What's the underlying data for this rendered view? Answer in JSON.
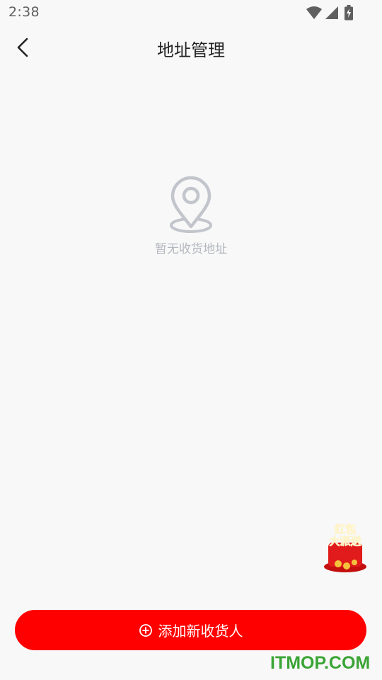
{
  "status_bar": {
    "time": "2:38",
    "icons": [
      "wifi-icon",
      "signal-icon",
      "battery-charging-icon"
    ]
  },
  "nav": {
    "back_icon": "chevron-left-icon",
    "title": "地址管理"
  },
  "empty_state": {
    "icon": "location-pin-icon",
    "message": "暂无收货地址"
  },
  "promo": {
    "line1": "红包",
    "line2": "大派送"
  },
  "add_button": {
    "icon": "plus-circle-icon",
    "label": "添加新收货人"
  },
  "watermark": "ITMOP.COM",
  "colors": {
    "accent": "#ff0000",
    "background": "#f8f8f8",
    "muted_text": "#b5b8c0",
    "watermark": "#3aa435"
  }
}
